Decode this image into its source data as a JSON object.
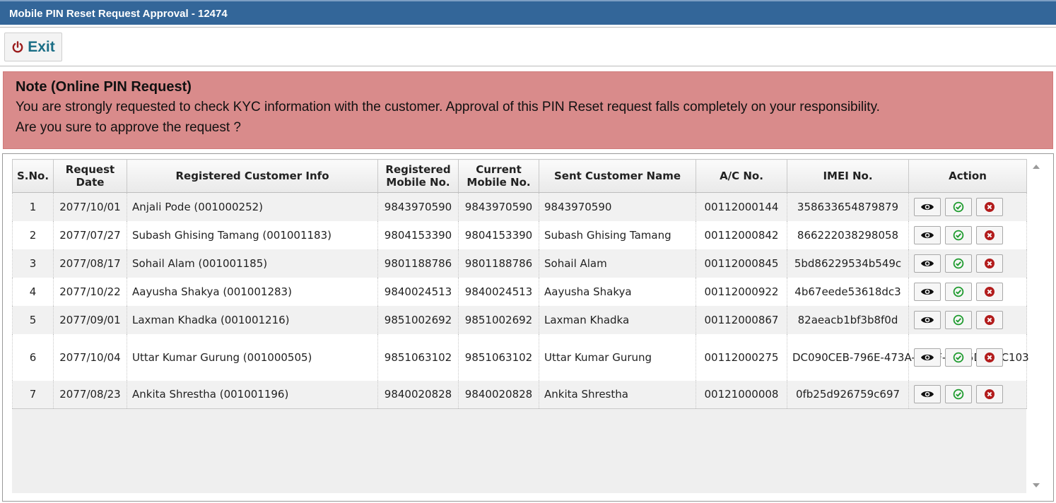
{
  "window": {
    "title": "Mobile PIN Reset Request Approval - 12474"
  },
  "toolbar": {
    "exit_label": "Exit",
    "exit_icon": "power-icon"
  },
  "note": {
    "title": "Note (Online PIN Request)",
    "line1": "You are strongly requested to check KYC information with the customer. Approval of this PIN Reset request falls completely on your responsibility.",
    "line2": "Are you sure to approve the request ?"
  },
  "colors": {
    "titlebar": "#336699",
    "note_bg": "#d98b8b",
    "exit_text": "#1a6e86",
    "approve": "#1e9b2e",
    "reject": "#b21c1c"
  },
  "table": {
    "headers": {
      "sno": "S.No.",
      "request_date_1": "Request",
      "request_date_2": "Date",
      "customer_info": "Registered Customer Info",
      "reg_mobile_1": "Registered",
      "reg_mobile_2": "Mobile No.",
      "cur_mobile_1": "Current",
      "cur_mobile_2": "Mobile No.",
      "sent_name": "Sent Customer Name",
      "ac_no": "A/C No.",
      "imei": "IMEI No.",
      "action": "Action"
    },
    "action_icons": [
      "view-icon",
      "approve-icon",
      "reject-icon"
    ],
    "rows": [
      {
        "sno": "1",
        "date": "2077/10/01",
        "info": "Anjali Pode (001000252)",
        "reg_mobile": "9843970590",
        "cur_mobile": "9843970590",
        "sent_name": "9843970590",
        "ac_no": "00112000144",
        "imei": "358633654879879"
      },
      {
        "sno": "2",
        "date": "2077/07/27",
        "info": "Subash Ghising Tamang (001001183)",
        "reg_mobile": "9804153390",
        "cur_mobile": "9804153390",
        "sent_name": "Subash Ghising Tamang",
        "ac_no": "00112000842",
        "imei": "866222038298058"
      },
      {
        "sno": "3",
        "date": "2077/08/17",
        "info": "Sohail Alam (001001185)",
        "reg_mobile": "9801188786",
        "cur_mobile": "9801188786",
        "sent_name": "Sohail Alam",
        "ac_no": "00112000845",
        "imei": "5bd86229534b549c"
      },
      {
        "sno": "4",
        "date": "2077/10/22",
        "info": "Aayusha Shakya (001001283)",
        "reg_mobile": "9840024513",
        "cur_mobile": "9840024513",
        "sent_name": "Aayusha Shakya",
        "ac_no": "00112000922",
        "imei": "4b67eede53618dc3"
      },
      {
        "sno": "5",
        "date": "2077/09/01",
        "info": "Laxman Khadka (001001216)",
        "reg_mobile": "9851002692",
        "cur_mobile": "9851002692",
        "sent_name": "Laxman Khadka",
        "ac_no": "00112000867",
        "imei": "82aeacb1bf3b8f0d"
      },
      {
        "sno": "6",
        "date": "2077/10/04",
        "info": "Uttar Kumar Gurung (001000505)",
        "reg_mobile": "9851063102",
        "cur_mobile": "9851063102",
        "sent_name": "Uttar Kumar Gurung",
        "ac_no": "00112000275",
        "imei": "DC090CEB-796E-473A-8CEF-8C05DEFEC103"
      },
      {
        "sno": "7",
        "date": "2077/08/23",
        "info": "Ankita Shrestha (001001196)",
        "reg_mobile": "9840020828",
        "cur_mobile": "9840020828",
        "sent_name": "Ankita Shrestha",
        "ac_no": "00121000008",
        "imei": "0fb25d926759c697"
      }
    ]
  }
}
